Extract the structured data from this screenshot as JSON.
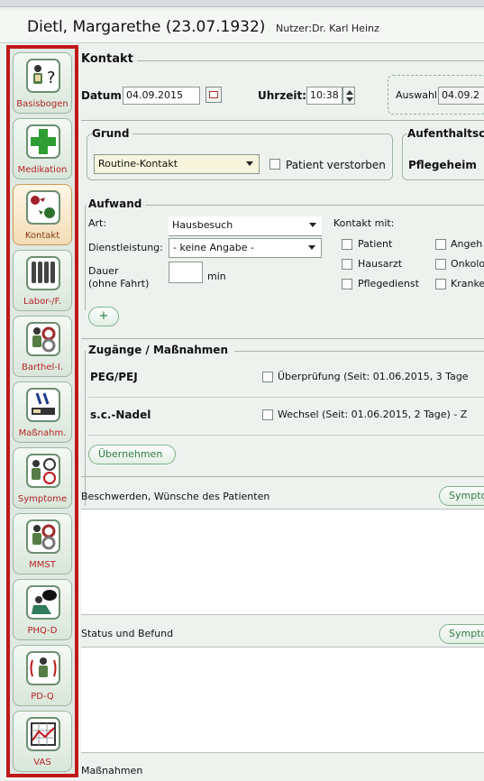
{
  "header": {
    "patient": "Dietl, Margarethe (23.07.1932)",
    "user": "Nutzer:Dr. Karl Heinz"
  },
  "sidebar": {
    "items": [
      {
        "label": "Basisbogen",
        "icon": "person-question-icon"
      },
      {
        "label": "Medikation",
        "icon": "green-cross-icon"
      },
      {
        "label": "Kontakt",
        "icon": "conversation-icon"
      },
      {
        "label": "Labor-/F.",
        "icon": "test-tubes-icon"
      },
      {
        "label": "Barthel-I.",
        "icon": "person-gears-icon"
      },
      {
        "label": "Maßnahm.",
        "icon": "patient-bed-icon"
      },
      {
        "label": "Symptome",
        "icon": "person-faces-icon"
      },
      {
        "label": "MMST",
        "icon": "person-gears-icon"
      },
      {
        "label": "PHQ-D",
        "icon": "depressed-person-icon"
      },
      {
        "label": "PD-Q",
        "icon": "person-alarm-icon"
      },
      {
        "label": "VAS",
        "icon": "chart-grid-icon"
      }
    ]
  },
  "kontakt": {
    "section_title": "Kontakt",
    "datum_label": "Datum:",
    "datum_value": "04.09.2015",
    "uhrzeit_label": "Uhrzeit:",
    "uhrzeit_value": "10:38",
    "auswahl_label": "Auswahl:",
    "auswahl_value": "04.09.2"
  },
  "grund": {
    "title": "Grund",
    "selected": "Routine-Kontakt",
    "verstorben_label": "Patient verstorben"
  },
  "aufenthalt": {
    "title": "Aufenthaltsc",
    "value": "Pflegeheim"
  },
  "aufwand": {
    "title": "Aufwand",
    "art_label": "Art:",
    "art_value": "Hausbesuch",
    "dienst_label": "Dienstleistung:",
    "dienst_value": "- keine Angabe -",
    "dauer_label1": "Dauer",
    "dauer_label2": "(ohne Fahrt)",
    "dauer_unit": "min",
    "kontakt_mit_label": "Kontakt mit:",
    "kontakt_opts_col1": [
      "Patient",
      "Hausarzt",
      "Pflegedienst"
    ],
    "kontakt_opts_col2": [
      "Angeh",
      "Onkolo",
      "Kranke"
    ],
    "add_label": "+"
  },
  "zugaenge": {
    "title": "Zugänge / Maßnahmen",
    "rows": [
      {
        "name": "PEG/PEJ",
        "text": "Überprüfung (Seit: 01.06.2015, 3 Tage"
      },
      {
        "name": "s.c.-Nadel",
        "text": "Wechsel (Seit: 01.06.2015, 2 Tage) - Z"
      }
    ],
    "uebernehmen": "Übernehmen"
  },
  "beschwerden": {
    "label": "Beschwerden, Wünsche des Patienten",
    "button": "Sympto"
  },
  "status": {
    "label": "Status und Befund",
    "button": "Sympto"
  },
  "massnahmen": {
    "label": "Maßnahmen"
  }
}
